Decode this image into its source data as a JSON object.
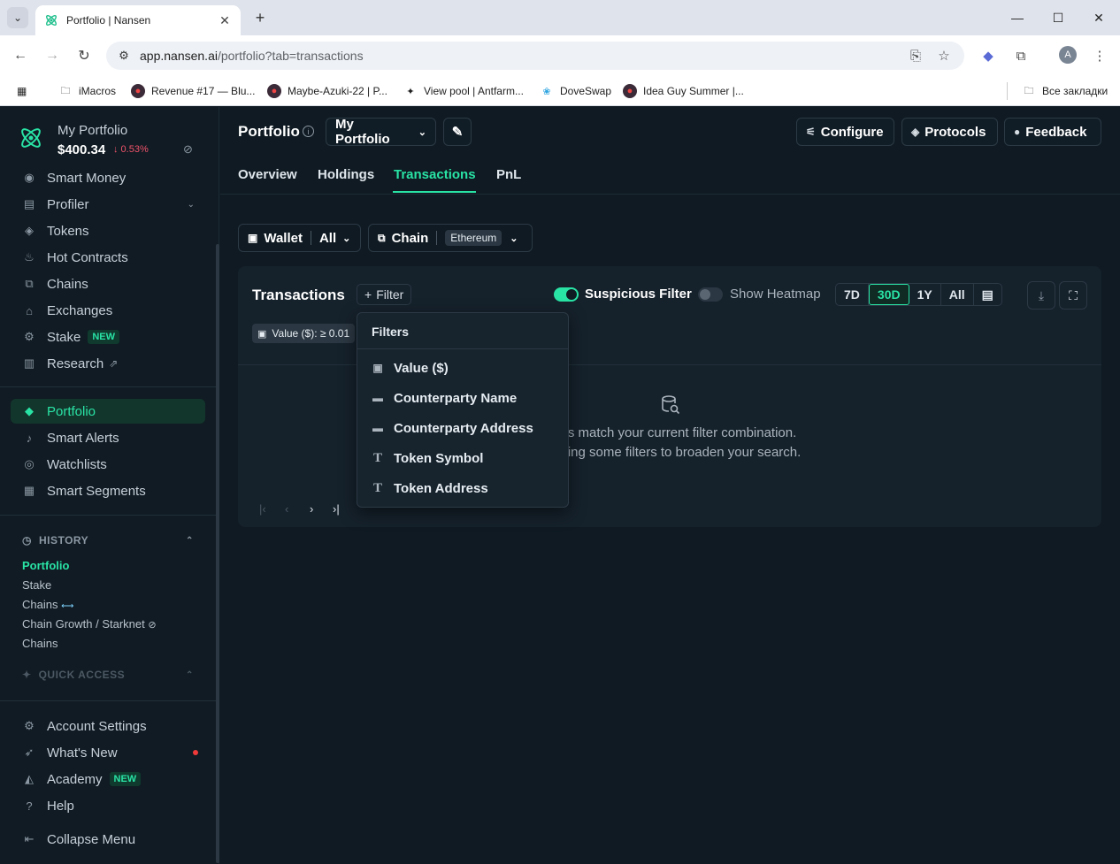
{
  "browser": {
    "tab_title": "Portfolio | Nansen",
    "url_host": "app.nansen.ai",
    "url_path": "/portfolio?tab=transactions",
    "avatar_letter": "A",
    "bookmarks": [
      {
        "label": "iMacros",
        "icon": "folder-icon"
      },
      {
        "label": "Revenue #17 — Blu...",
        "icon": "eye-avatar-icon"
      },
      {
        "label": "Maybe-Azuki-22 | P...",
        "icon": "eye-avatar-icon"
      },
      {
        "label": "View pool | Antfarm...",
        "icon": "diamond-icon"
      },
      {
        "label": "DoveSwap",
        "icon": "dove-icon"
      },
      {
        "label": "Idea Guy Summer |...",
        "icon": "eye-avatar-icon"
      }
    ],
    "all_bookmarks": "Все закладки"
  },
  "sidebar": {
    "portfolio_name": "My Portfolio",
    "portfolio_value": "$400.34",
    "portfolio_change": "↓ 0.53%",
    "nav_top": [
      {
        "label": "Smart Money",
        "icon": "smart-money-icon"
      },
      {
        "label": "Profiler",
        "icon": "profiler-icon"
      },
      {
        "label": "Tokens",
        "icon": "tokens-icon"
      },
      {
        "label": "Hot Contracts",
        "icon": "flame-icon"
      },
      {
        "label": "Chains",
        "icon": "chains-icon"
      },
      {
        "label": "Exchanges",
        "icon": "bank-icon"
      },
      {
        "label": "Stake",
        "icon": "stake-icon",
        "badge": "NEW"
      },
      {
        "label": "Research",
        "icon": "document-icon"
      }
    ],
    "nav_mid": [
      {
        "label": "Portfolio",
        "icon": "portfolio-icon"
      },
      {
        "label": "Smart Alerts",
        "icon": "bell-icon"
      },
      {
        "label": "Watchlists",
        "icon": "eye-icon"
      },
      {
        "label": "Smart Segments",
        "icon": "segments-icon"
      }
    ],
    "history_title": "HISTORY",
    "history": [
      "Portfolio",
      "Stake",
      "Chains",
      "Chain Growth / Starknet",
      "Chains"
    ],
    "quick_access_title": "QUICK ACCESS",
    "nav_bottom": [
      {
        "label": "Account Settings",
        "icon": "gear-icon"
      },
      {
        "label": "What's New",
        "icon": "rocket-icon"
      },
      {
        "label": "Academy",
        "icon": "graduation-cap-icon",
        "badge": "NEW"
      },
      {
        "label": "Help",
        "icon": "help-icon"
      },
      {
        "label": "Collapse Menu",
        "icon": "collapse-icon"
      }
    ]
  },
  "header": {
    "title": "Portfolio",
    "portfolio_select": "My Portfolio",
    "configure": "Configure",
    "protocols": "Protocols",
    "feedback": "Feedback"
  },
  "tabs": [
    "Overview",
    "Holdings",
    "Transactions",
    "PnL"
  ],
  "active_tab": "Transactions",
  "filters_bar": {
    "wallet_label": "Wallet",
    "wallet_value": "All",
    "chain_label": "Chain",
    "chain_value": "Ethereum"
  },
  "transactions": {
    "title": "Transactions",
    "filter_button": "Filter",
    "suspicious_filter": "Suspicious Filter",
    "suspicious_on": true,
    "show_heatmap": "Show Heatmap",
    "heatmap_on": false,
    "ranges": [
      "7D",
      "30D",
      "1Y",
      "All"
    ],
    "active_range": "30D",
    "active_filter_chip": "Value ($): ≥ 0.01",
    "empty_line1": "ults match your current filter combination.",
    "empty_line2": "oving some filters to broaden your search."
  },
  "filters_dropdown": {
    "title": "Filters",
    "items": [
      {
        "label": "Value ($)",
        "icon": "money-icon"
      },
      {
        "label": "Counterparty Name",
        "icon": "wallet-icon"
      },
      {
        "label": "Counterparty Address",
        "icon": "wallet-icon"
      },
      {
        "label": "Token Symbol",
        "icon": "text-icon"
      },
      {
        "label": "Token Address",
        "icon": "text-icon"
      }
    ]
  },
  "colors": {
    "accent": "#29e3a5",
    "background": "#0f1a22",
    "panel": "#15212b",
    "negative": "#f0536b"
  }
}
